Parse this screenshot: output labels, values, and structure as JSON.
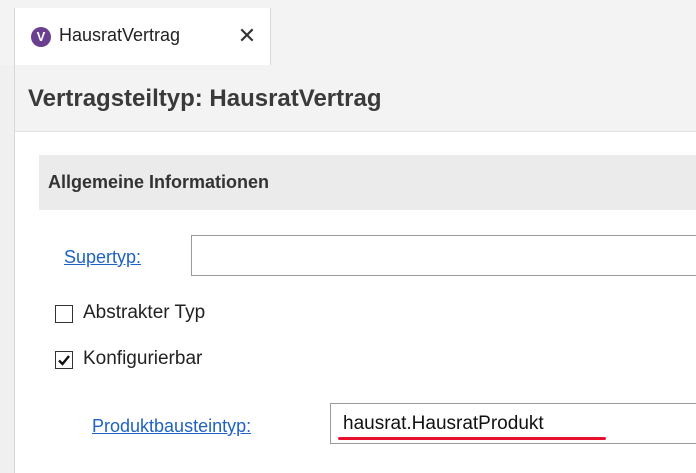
{
  "tab": {
    "icon_letter": "V",
    "icon": "product-part-icon",
    "title": "HausratVertrag",
    "close_glyph": "✕",
    "close_icon": "close-icon"
  },
  "header": {
    "title": "Vertragsteiltyp: HausratVertrag"
  },
  "section": {
    "title": "Allgemeine Informationen"
  },
  "fields": {
    "supertype": {
      "label": "Supertyp:",
      "value": ""
    },
    "abstract": {
      "label": "Abstrakter Typ",
      "checked": false
    },
    "configurable": {
      "label": "Konfigurierbar",
      "checked": true
    },
    "product_component_type": {
      "label": "Produktbausteintyp:",
      "value": "hausrat.HausratProdukt"
    }
  },
  "colors": {
    "link": "#1e62c4",
    "highlight_underline": "#e8112d",
    "icon_purple": "#6a3f8f"
  }
}
